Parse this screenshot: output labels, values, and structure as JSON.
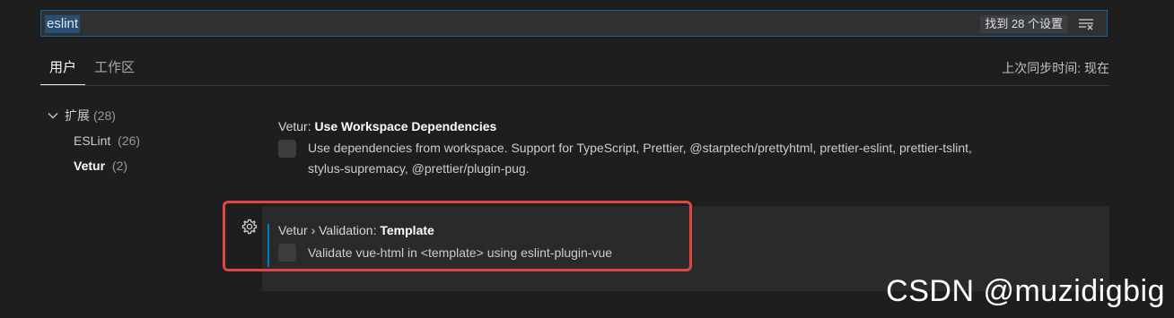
{
  "search": {
    "value": "eslint",
    "result_count": "找到 28 个设置",
    "clear_icon": "clear-filter-icon"
  },
  "tabs": [
    {
      "label": "用户",
      "active": true
    },
    {
      "label": "工作区",
      "active": false
    }
  ],
  "sync_status": "上次同步时间: 现在",
  "toc": {
    "group": {
      "label": "扩展",
      "count": "(28)",
      "icon": "chevron-down-icon"
    },
    "items": [
      {
        "label": "ESLint",
        "count": "(26)",
        "active": false
      },
      {
        "label": "Vetur",
        "count": "(2)",
        "active": true
      }
    ]
  },
  "settings": [
    {
      "category": "Vetur: ",
      "name": "Use Workspace Dependencies",
      "description_line1": "Use dependencies from workspace. Support for TypeScript, Prettier, @starptech/prettyhtml, prettier-eslint, prettier-tslint,",
      "description_line2": "stylus-supremacy, @prettier/plugin-pug.",
      "checked": false
    },
    {
      "category": "Vetur › Validation: ",
      "name": "Template",
      "description": "Validate vue-html in <template> using eslint-plugin-vue",
      "checked": false,
      "icon": "gear-icon"
    }
  ],
  "watermark": "CSDN @muzidigbig",
  "colors": {
    "accent": "#007acc",
    "highlight": "#e04545",
    "background": "#1e1e1e"
  }
}
